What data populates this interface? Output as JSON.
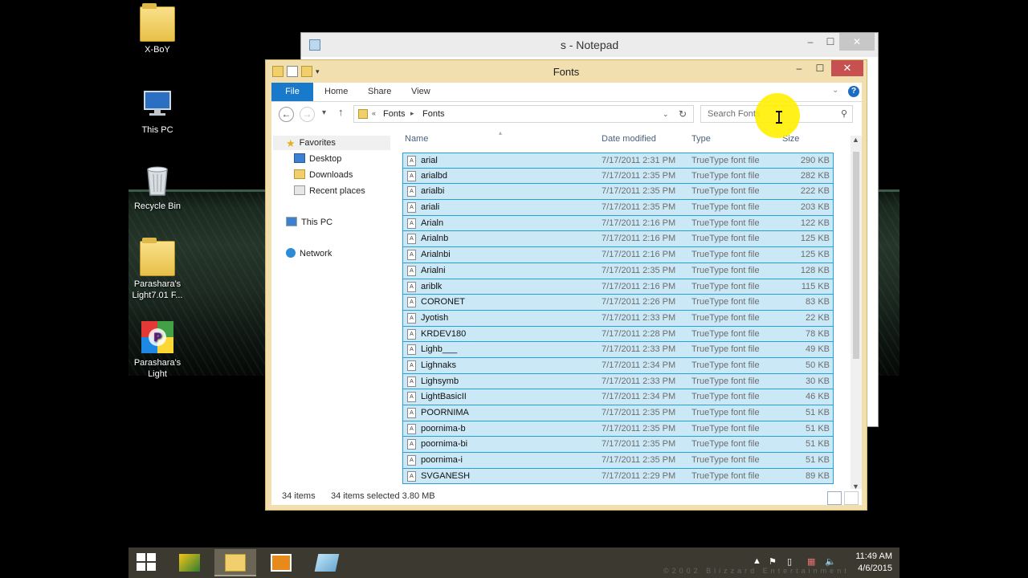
{
  "desktop": {
    "icons": [
      {
        "label": "X-BoY"
      },
      {
        "label": "This PC"
      },
      {
        "label": "Recycle Bin"
      },
      {
        "label": "Parashara's Light7.01 F..."
      },
      {
        "label": "Parashara's Light"
      }
    ]
  },
  "notepad": {
    "title": "s - Notepad",
    "minimize": "‒",
    "maximize": "☐",
    "close": "✕"
  },
  "explorer": {
    "title": "Fonts",
    "window_controls": {
      "minimize": "–",
      "maximize": "☐",
      "close": "✕"
    },
    "ribbon": {
      "file": "File",
      "home": "Home",
      "share": "Share",
      "view": "View",
      "help": "?"
    },
    "address": {
      "overflow": "«",
      "crumbs": [
        "Fonts",
        "Fonts"
      ]
    },
    "search": {
      "placeholder": "Search Fonts"
    },
    "nav": {
      "favorites": "Favorites",
      "desktop": "Desktop",
      "downloads": "Downloads",
      "recent": "Recent places",
      "this_pc": "This PC",
      "network": "Network"
    },
    "columns": {
      "name": "Name",
      "date": "Date modified",
      "type": "Type",
      "size": "Size"
    },
    "files": [
      {
        "name": "arial",
        "date": "7/17/2011 2:31 PM",
        "type": "TrueType font file",
        "size": "290 KB"
      },
      {
        "name": "arialbd",
        "date": "7/17/2011 2:35 PM",
        "type": "TrueType font file",
        "size": "282 KB"
      },
      {
        "name": "arialbi",
        "date": "7/17/2011 2:35 PM",
        "type": "TrueType font file",
        "size": "222 KB"
      },
      {
        "name": "ariali",
        "date": "7/17/2011 2:35 PM",
        "type": "TrueType font file",
        "size": "203 KB"
      },
      {
        "name": "Arialn",
        "date": "7/17/2011 2:16 PM",
        "type": "TrueType font file",
        "size": "122 KB"
      },
      {
        "name": "Arialnb",
        "date": "7/17/2011 2:16 PM",
        "type": "TrueType font file",
        "size": "125 KB"
      },
      {
        "name": "Arialnbi",
        "date": "7/17/2011 2:16 PM",
        "type": "TrueType font file",
        "size": "125 KB"
      },
      {
        "name": "Arialni",
        "date": "7/17/2011 2:35 PM",
        "type": "TrueType font file",
        "size": "128 KB"
      },
      {
        "name": "ariblk",
        "date": "7/17/2011 2:16 PM",
        "type": "TrueType font file",
        "size": "115 KB"
      },
      {
        "name": "CORONET",
        "date": "7/17/2011 2:26 PM",
        "type": "TrueType font file",
        "size": "83 KB"
      },
      {
        "name": "Jyotish",
        "date": "7/17/2011 2:33 PM",
        "type": "TrueType font file",
        "size": "22 KB"
      },
      {
        "name": "KRDEV180",
        "date": "7/17/2011 2:28 PM",
        "type": "TrueType font file",
        "size": "78 KB"
      },
      {
        "name": "Lighb___",
        "date": "7/17/2011 2:33 PM",
        "type": "TrueType font file",
        "size": "49 KB"
      },
      {
        "name": "Lighnaks",
        "date": "7/17/2011 2:34 PM",
        "type": "TrueType font file",
        "size": "50 KB"
      },
      {
        "name": "Lighsymb",
        "date": "7/17/2011 2:33 PM",
        "type": "TrueType font file",
        "size": "30 KB"
      },
      {
        "name": "LightBasicII",
        "date": "7/17/2011 2:34 PM",
        "type": "TrueType font file",
        "size": "46 KB"
      },
      {
        "name": "POORNIMA",
        "date": "7/17/2011 2:35 PM",
        "type": "TrueType font file",
        "size": "51 KB"
      },
      {
        "name": "poornima-b",
        "date": "7/17/2011 2:35 PM",
        "type": "TrueType font file",
        "size": "51 KB"
      },
      {
        "name": "poornima-bi",
        "date": "7/17/2011 2:35 PM",
        "type": "TrueType font file",
        "size": "51 KB"
      },
      {
        "name": "poornima-i",
        "date": "7/17/2011 2:35 PM",
        "type": "TrueType font file",
        "size": "51 KB"
      },
      {
        "name": "SVGANESH",
        "date": "7/17/2011 2:29 PM",
        "type": "TrueType font file",
        "size": "89 KB"
      }
    ],
    "status": {
      "items": "34 items",
      "selected": "34 items selected  3.80 MB"
    }
  },
  "taskbar": {
    "clock_time": "11:49 AM",
    "clock_date": "4/6/2015",
    "watermark": "©2002 Blizzard Entertainment"
  },
  "colors": {
    "explorer_frame": "#f2dfb0",
    "selection_fill": "#cbe8f6",
    "selection_border": "#26a0da",
    "file_tab": "#1979ca",
    "close_button": "#c75050",
    "taskbar": "#3c3930",
    "cursor_highlight": "#ffef00"
  }
}
